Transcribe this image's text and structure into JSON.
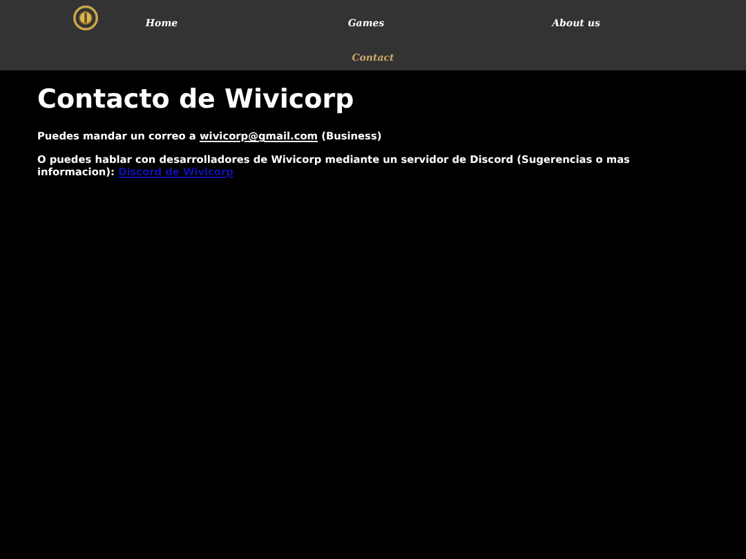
{
  "nav": {
    "items": [
      {
        "label": "Home",
        "selected": false
      },
      {
        "label": "Games",
        "selected": false
      },
      {
        "label": "About us",
        "selected": false
      },
      {
        "label": "Contact",
        "selected": true
      }
    ]
  },
  "heading": "Contacto de Wivicorp",
  "paragraphs": [
    {
      "kind": "email",
      "before": "Puedes mandar un correo a ",
      "link": "wivicorp@gmail.com",
      "after": " (Business)"
    },
    {
      "kind": "web",
      "before": "O puedes hablar con desarrolladores de Wivicorp mediante un servidor de Discord (Sugerencias o mas informacion): ",
      "link": "Discord de Wivicorp"
    }
  ]
}
